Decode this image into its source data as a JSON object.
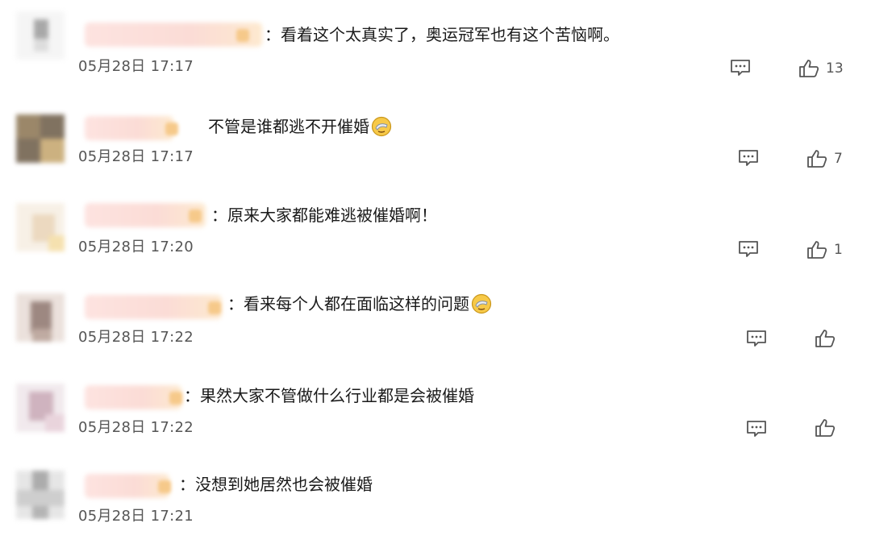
{
  "icons": {
    "reply": "comment-bubble-icon",
    "like": "thumbs-up-icon",
    "emoji": "facepalm-emoji-icon"
  },
  "colors": {
    "text": "#1a1a1a",
    "timestamp": "#555555",
    "icon_stroke": "#555555",
    "name_blur": "#fbdcd6"
  },
  "comments": [
    {
      "text": "：看着这个太真实了，奥运冠军也有这个苦恼啊。",
      "time": "05月28日 17:17",
      "likes": "13",
      "has_emoji": false
    },
    {
      "text": "不管是谁都逃不开催婚",
      "time": "05月28日 17:17",
      "likes": "7",
      "has_emoji": true
    },
    {
      "text": "：原来大家都能难逃被催婚啊！",
      "time": "05月28日 17:20",
      "likes": "1",
      "has_emoji": false
    },
    {
      "text": "：看来每个人都在面临这样的问题",
      "time": "05月28日 17:22",
      "likes": "",
      "has_emoji": true
    },
    {
      "text": "：果然大家不管做什么行业都是会被催婚",
      "time": "05月28日 17:22",
      "likes": "",
      "has_emoji": false
    },
    {
      "text": "：没想到她居然也会被催婚",
      "time": "05月28日 17:21",
      "likes": "",
      "has_emoji": false
    }
  ]
}
